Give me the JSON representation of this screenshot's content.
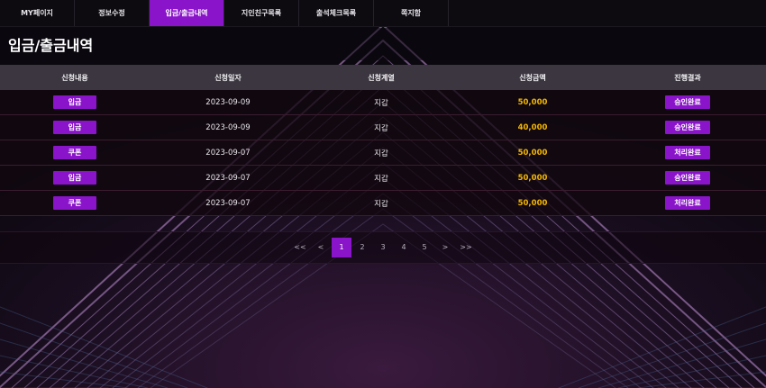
{
  "nav": {
    "tabs": [
      {
        "label": "MY페이지",
        "active": false
      },
      {
        "label": "정보수정",
        "active": false
      },
      {
        "label": "입금/출금내역",
        "active": true
      },
      {
        "label": "지인친구목록",
        "active": false
      },
      {
        "label": "출석체크목록",
        "active": false
      },
      {
        "label": "쪽지함",
        "active": false
      }
    ]
  },
  "page": {
    "title": "입금/출금내역"
  },
  "table": {
    "headers": [
      "신청내용",
      "신청일자",
      "신청계열",
      "신청금액",
      "진행결과"
    ],
    "rows": [
      {
        "type": "입금",
        "date": "2023-09-09",
        "wallet": "지갑",
        "amount": "50,000",
        "status": "승인완료"
      },
      {
        "type": "입금",
        "date": "2023-09-09",
        "wallet": "지갑",
        "amount": "40,000",
        "status": "승인완료"
      },
      {
        "type": "쿠폰",
        "date": "2023-09-07",
        "wallet": "지갑",
        "amount": "50,000",
        "status": "처리완료"
      },
      {
        "type": "입금",
        "date": "2023-09-07",
        "wallet": "지갑",
        "amount": "50,000",
        "status": "승인완료"
      },
      {
        "type": "쿠폰",
        "date": "2023-09-07",
        "wallet": "지갑",
        "amount": "50,000",
        "status": "처리완료"
      }
    ]
  },
  "pagination": {
    "first": "<<",
    "prev": "<",
    "pages": [
      "1",
      "2",
      "3",
      "4",
      "5"
    ],
    "current": "1",
    "next": ">",
    "last": ">>"
  },
  "colors": {
    "accent": "#8a14c9",
    "amount": "#f5b800",
    "header_bg": "#3b363f"
  }
}
